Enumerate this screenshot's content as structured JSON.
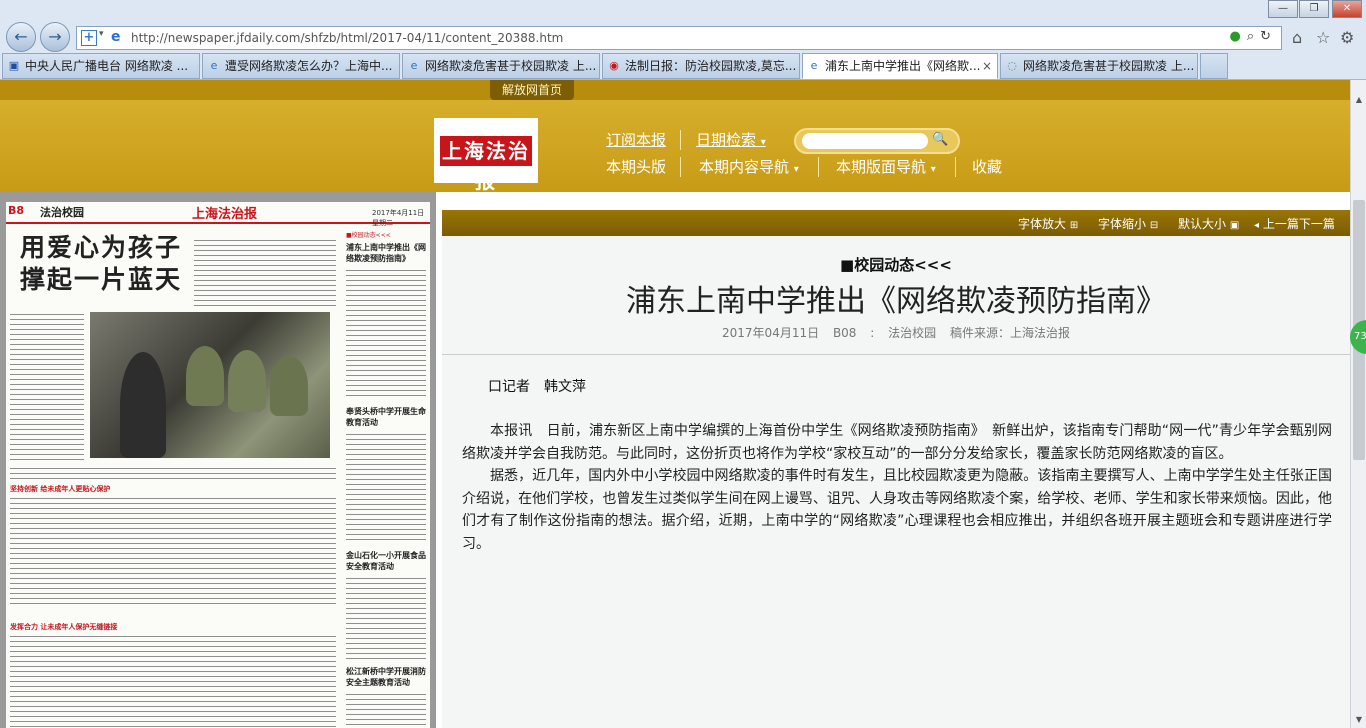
{
  "browser": {
    "url": "http://newspaper.jfdaily.com/shfzb/html/2017-04/11/content_20388.htm",
    "tabs": [
      {
        "label": "中央人民广播电台 网络欺凌 ...",
        "active": false
      },
      {
        "label": "遭受网络欺凌怎么办？上海中...",
        "active": false
      },
      {
        "label": "网络欺凌危害甚于校园欺凌 上...",
        "active": false
      },
      {
        "label": "法制日报：防治校园欺凌,莫忘...",
        "active": false
      },
      {
        "label": "浦东上南中学推出《网络欺...",
        "active": true
      },
      {
        "label": "网络欺凌危害甚于校园欺凌 上...",
        "active": false
      }
    ],
    "icons": [
      "back-icon",
      "forward-icon",
      "add-icon",
      "ie-icon",
      "search-icon",
      "refresh-icon",
      "home-icon",
      "star-icon",
      "gear-icon"
    ]
  },
  "site": {
    "home_link": "解放网首页",
    "logo_text": "上海法治报",
    "nav": {
      "subscribe": "订阅本报",
      "date_search": "日期检索",
      "front_page": "本期头版",
      "content_nav": "本期内容导航",
      "layout_nav": "本期版面导航",
      "favorite": "收藏"
    }
  },
  "paper": {
    "section_code": "B8",
    "section_name": "法治校园",
    "masthead": "上海法治报",
    "date": "2017年4月11日 星期二",
    "headline_line1": "用爱心为孩子",
    "headline_line2": "撑起一片蓝天",
    "band1": "坚持创新  给未成年人更贴心保护",
    "band2": "发挥合力  让未成年人保护无缝链接",
    "side_label": "■校园动态<<<",
    "side_items": [
      {
        "title": "浦东上南中学推出《网络欺凌预防指南》"
      },
      {
        "title": "奉贤头桥中学开展生命教育活动"
      },
      {
        "title": "金山石化一小开展食品安全教育活动"
      },
      {
        "title": "松江新桥中学开展消防安全主题教育活动"
      }
    ]
  },
  "article": {
    "toolbar": {
      "font_bigger": "字体放大",
      "font_smaller": "字体缩小",
      "font_default": "默认大小",
      "prev_next": "上一篇下一篇"
    },
    "kicker": "■校园动态<<<",
    "title": "浦东上南中学推出《网络欺凌预防指南》",
    "meta": {
      "date": "2017年04月11日",
      "page": "B08 : 法治校园",
      "source": "稿件来源：上海法治报"
    },
    "reporter": "口记者　韩文萍",
    "paragraphs": [
      "本报讯　日前，浦东新区上南中学编撰的上海首份中学生《网络欺凌预防指南》　新鲜出炉，该指南专门帮助“网一代”青少年学会甄别网络欺凌并学会自我防范。与此同时，这份折页也将作为学校“家校互动”的一部分分发给家长，覆盖家长防范网络欺凌的盲区。",
      "据悉，近几年，国内外中小学校园中网络欺凌的事件时有发生，且比校园欺凌更为隐蔽。该指南主要撰写人、上南中学学生处主任张正国介绍说，在他们学校，也曾发生过类似学生间在网上谩骂、诅咒、人身攻击等网络欺凌个案，给学校、老师、学生和家长带来烦恼。因此，他们才有了制作这份指南的想法。据介绍，近期，上南中学的“网络欺凌”心理课程也会相应推出，并组织各班开展主题班会和专题讲座进行学习。"
    ]
  },
  "badge": "73"
}
